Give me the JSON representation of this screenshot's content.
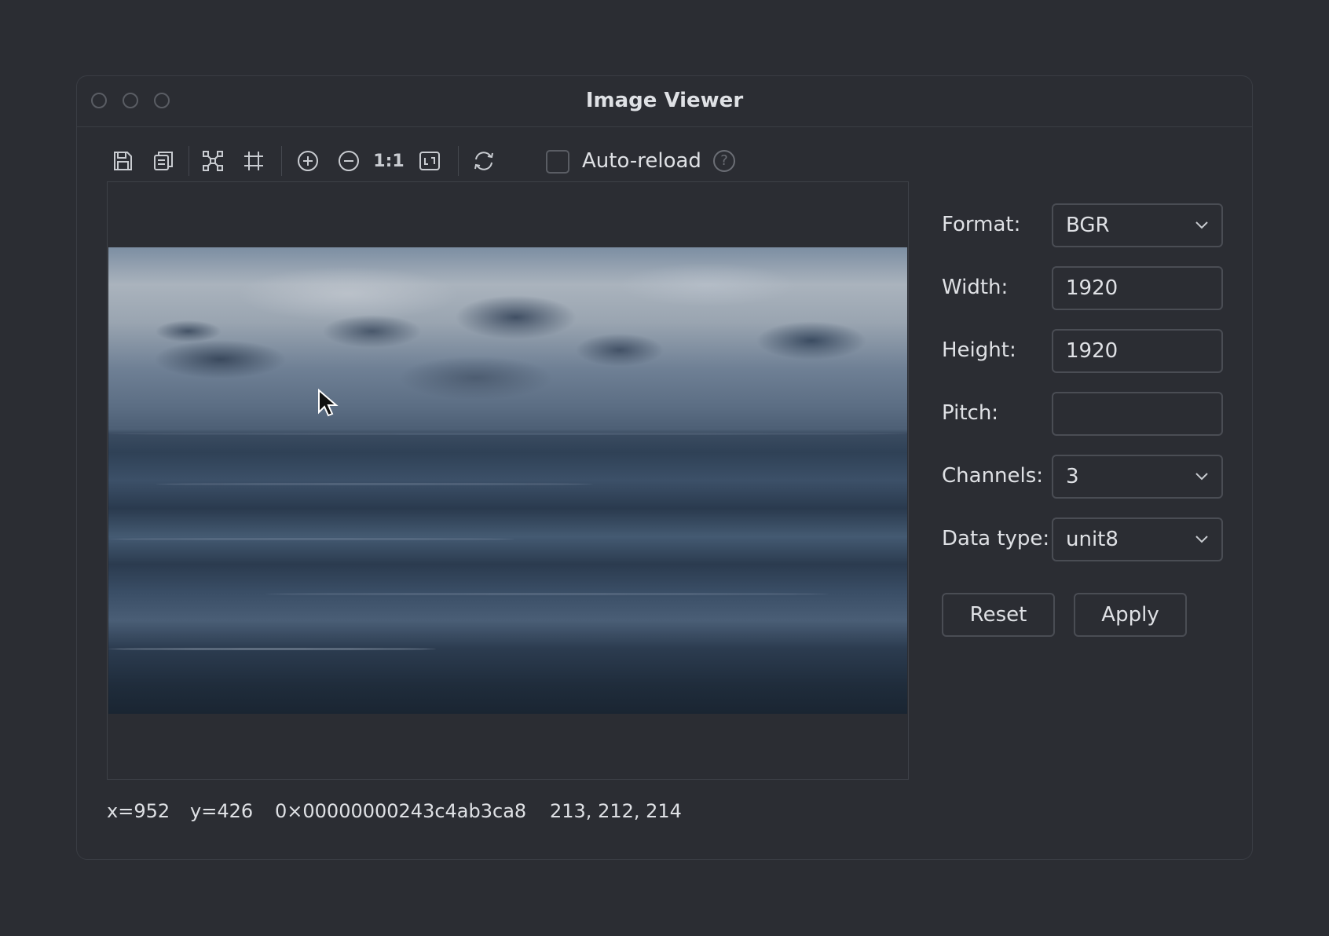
{
  "window": {
    "title": "Image Viewer"
  },
  "toolbar": {
    "icons": [
      "save-icon",
      "copy-icon",
      "fit-selection-icon",
      "crop-grid-icon",
      "zoom-in-icon",
      "zoom-out-icon",
      "actual-size-icon",
      "fit-window-icon",
      "reload-icon"
    ],
    "actual_size_label": "1:1",
    "auto_reload_label": "Auto-reload",
    "auto_reload_checked": false,
    "help_glyph": "?"
  },
  "status": {
    "x": "x=952",
    "y": "y=426",
    "address": "0×00000000243c4ab3ca8",
    "pixel": "213, 212, 214"
  },
  "form": {
    "format_label": "Format:",
    "format_value": "BGR",
    "width_label": "Width:",
    "width_value": "1920",
    "height_label": "Height:",
    "height_value": "1920",
    "pitch_label": "Pitch:",
    "pitch_value": "",
    "channels_label": "Channels:",
    "channels_value": "3",
    "datatype_label": "Data type:",
    "datatype_value": "unit8"
  },
  "buttons": {
    "reset": "Reset",
    "apply": "Apply"
  },
  "colors": {
    "background": "#2b2d33",
    "border": "#4a4d54",
    "text": "#dfe1e5"
  }
}
